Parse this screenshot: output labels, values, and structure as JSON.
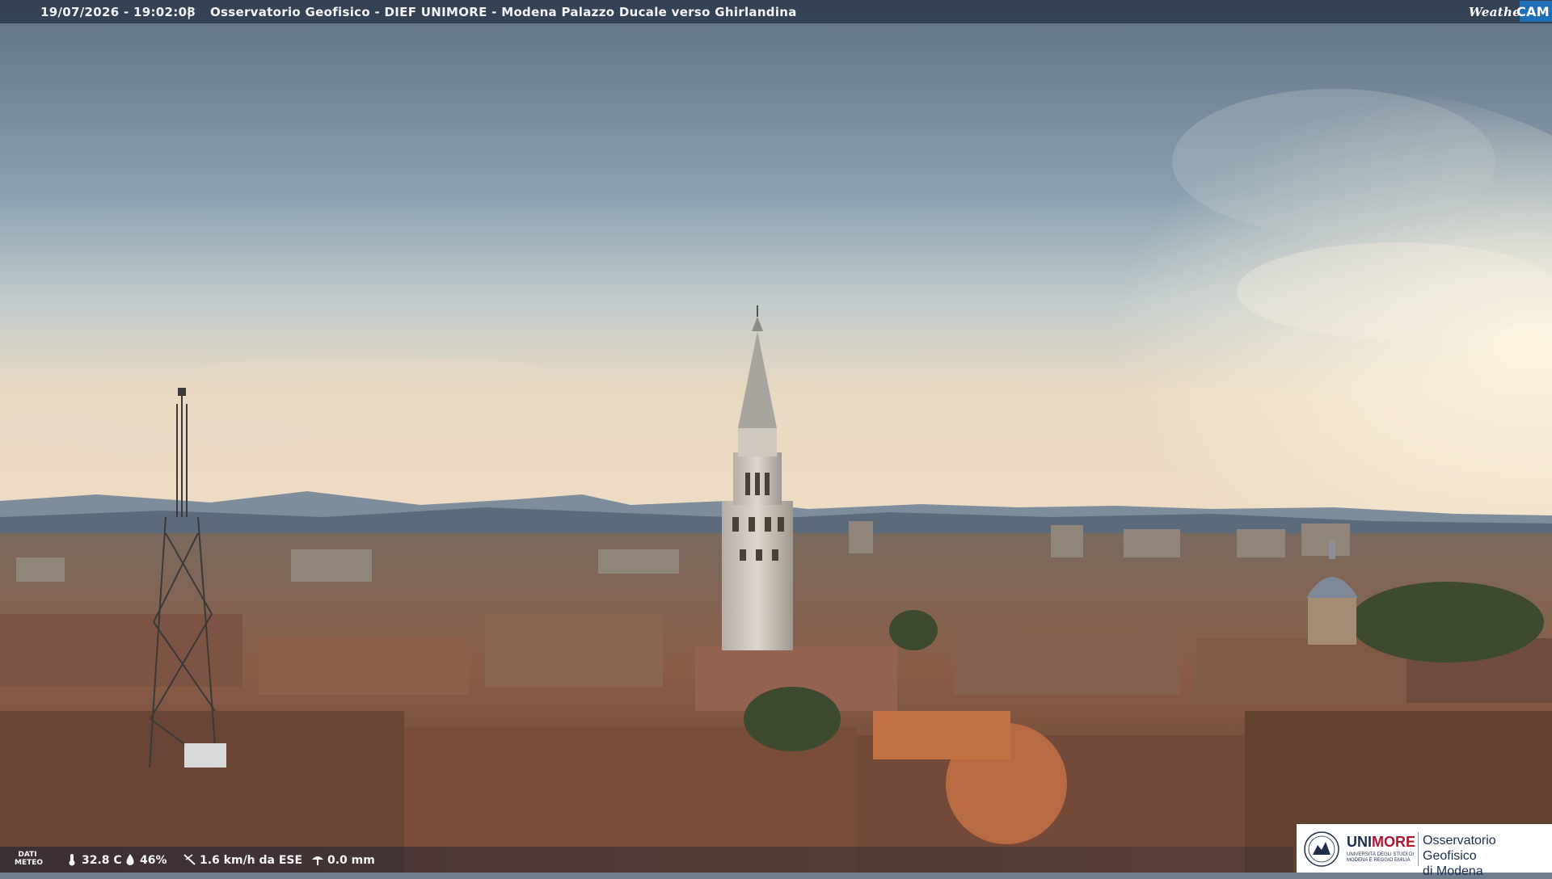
{
  "overlay": {
    "timestamp": "19/07/2026 - 19:02:08",
    "separator": "|",
    "camera_title": "Osservatorio Geofisico - DIEF UNIMORE - Modena Palazzo Ducale verso Ghirlandina",
    "brand_weather": "Weather",
    "brand_cam": "CAM"
  },
  "weather_bar": {
    "label": "DATI METEO",
    "temperature": "32.8 C",
    "humidity": "46%",
    "wind": "1.6 km/h da ESE",
    "rain": "0.0 mm",
    "icons": [
      "thermometer-icon",
      "humidity-icon",
      "wind-icon",
      "rain-gauge-icon"
    ]
  },
  "logo": {
    "uni_prefix": "UNI",
    "uni_suffix": "MORE",
    "uni_subtitle": "UNIVERSITÀ DEGLI STUDI DI MODENA E REGGIO EMILIA",
    "observatory_line1": "Osservatorio Geofisico",
    "observatory_line2": "di Modena"
  },
  "colors": {
    "uni_blue": "#1d2e4d",
    "unimore_red": "#b4142e",
    "weathercam_blue": "#1e6fb8",
    "sky_top": "#6a7b8e",
    "sky_horizon": "#ecdcc0"
  }
}
